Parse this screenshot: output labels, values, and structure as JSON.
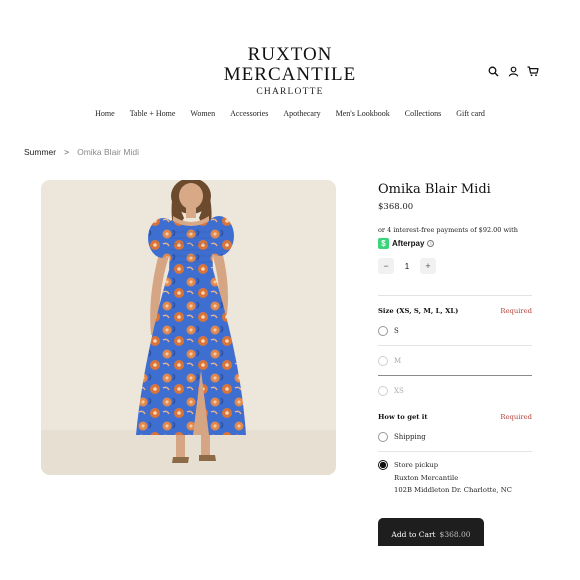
{
  "store": {
    "name_line1": "RUXTON",
    "name_line2": "MERCANTILE",
    "location": "CHARLOTTE"
  },
  "header_icons": [
    "search-icon",
    "account-icon",
    "cart-icon"
  ],
  "nav": [
    "Home",
    "Table + Home",
    "Women",
    "Accessories",
    "Apothecary",
    "Men's Lookbook",
    "Collections",
    "Gift card"
  ],
  "breadcrumb": {
    "parent": "Summer",
    "separator": ">",
    "current": "Omika Blair Midi"
  },
  "product": {
    "title": "Omika Blair Midi",
    "price": "$368.00",
    "afterpay_text": "or 4 interest-free payments of $92.00 with",
    "afterpay_logo_glyph": "$",
    "afterpay_name": "Afterpay",
    "afterpay_info": "i",
    "quantity": "1",
    "qty_minus": "−",
    "qty_plus": "+"
  },
  "size": {
    "label": "Size (XS, S, M, L, XL)",
    "required": "Required",
    "options": [
      {
        "label": "S",
        "state": "available"
      },
      {
        "label": "M",
        "state": "disabled"
      },
      {
        "label": "XS",
        "state": "disabled"
      }
    ]
  },
  "fulfillment": {
    "label": "How to get it",
    "required": "Required",
    "shipping": "Shipping",
    "pickup_title": "Store pickup",
    "pickup_store": "Ruxton Mercantile",
    "pickup_address": "102B Middleton Dr. Charlotte, NC",
    "selected": "Store pickup"
  },
  "cart_button": {
    "label": "Add to Cart",
    "price": "$368.00"
  },
  "colors": {
    "accent_required": "#b3403a",
    "button_bg": "#1e1e1e",
    "afterpay_green": "#3bd47a"
  }
}
